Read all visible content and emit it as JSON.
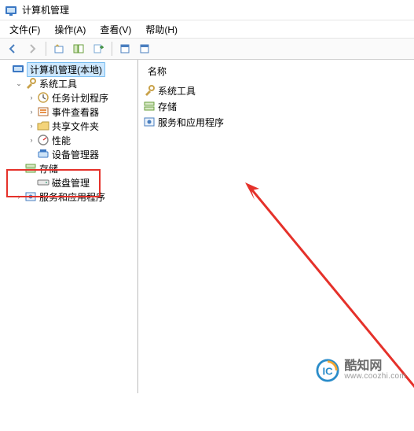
{
  "title": "计算机管理",
  "menus": {
    "file": "文件(F)",
    "action": "操作(A)",
    "view": "查看(V)",
    "help": "帮助(H)"
  },
  "column_header": "名称",
  "tree": {
    "root": "计算机管理(本地)",
    "system_tools": "系统工具",
    "task_scheduler": "任务计划程序",
    "event_viewer": "事件查看器",
    "shared_folders": "共享文件夹",
    "performance": "性能",
    "device_manager": "设备管理器",
    "storage": "存储",
    "disk_management": "磁盘管理",
    "services_apps": "服务和应用程序"
  },
  "right_items": {
    "system_tools": "系统工具",
    "storage": "存储",
    "services_apps": "服务和应用程序"
  },
  "watermark": {
    "cn": "酷知网",
    "en": "www.coozhi.com"
  }
}
